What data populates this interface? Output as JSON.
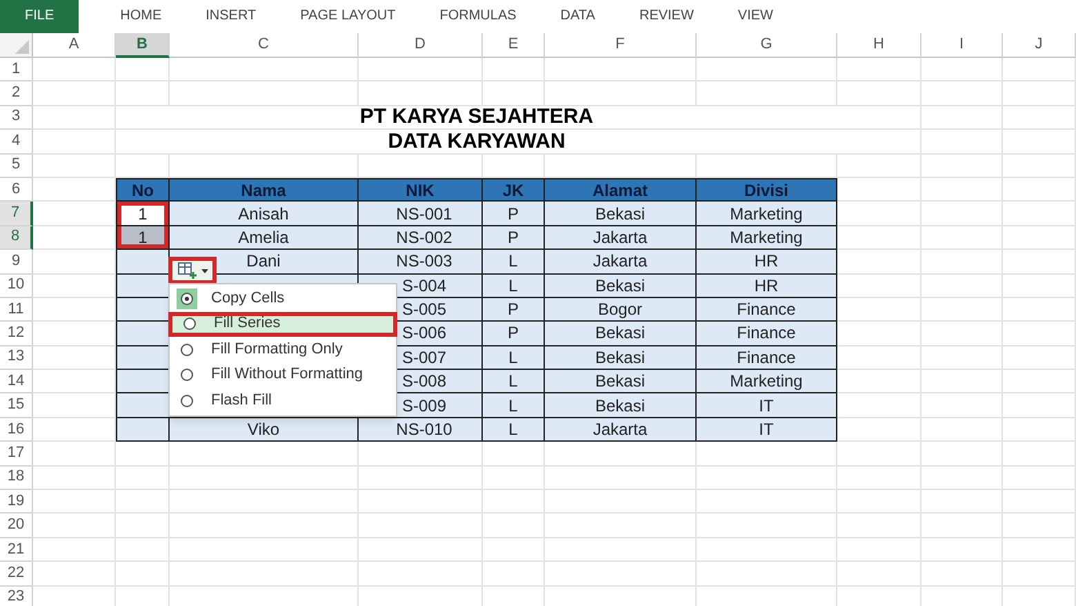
{
  "ribbon_tabs": [
    {
      "label": "FILE",
      "selected": true
    },
    {
      "label": "HOME",
      "selected": false
    },
    {
      "label": "INSERT",
      "selected": false
    },
    {
      "label": "PAGE LAYOUT",
      "selected": false
    },
    {
      "label": "FORMULAS",
      "selected": false
    },
    {
      "label": "DATA",
      "selected": false
    },
    {
      "label": "REVIEW",
      "selected": false
    },
    {
      "label": "VIEW",
      "selected": false
    }
  ],
  "columns": [
    {
      "label": "A",
      "selected": false
    },
    {
      "label": "B",
      "selected": true
    },
    {
      "label": "C",
      "selected": false
    },
    {
      "label": "D",
      "selected": false
    },
    {
      "label": "E",
      "selected": false
    },
    {
      "label": "F",
      "selected": false
    },
    {
      "label": "G",
      "selected": false
    },
    {
      "label": "H",
      "selected": false
    },
    {
      "label": "I",
      "selected": false
    },
    {
      "label": "J",
      "selected": false
    }
  ],
  "row_headers": [
    {
      "label": "1",
      "selected": false
    },
    {
      "label": "2",
      "selected": false
    },
    {
      "label": "3",
      "selected": false
    },
    {
      "label": "4",
      "selected": false
    },
    {
      "label": "5",
      "selected": false
    },
    {
      "label": "6",
      "selected": false
    },
    {
      "label": "7",
      "selected": true
    },
    {
      "label": "8",
      "selected": true
    },
    {
      "label": "9",
      "selected": false
    },
    {
      "label": "10",
      "selected": false
    },
    {
      "label": "11",
      "selected": false
    },
    {
      "label": "12",
      "selected": false
    },
    {
      "label": "13",
      "selected": false
    },
    {
      "label": "14",
      "selected": false
    },
    {
      "label": "15",
      "selected": false
    },
    {
      "label": "16",
      "selected": false
    },
    {
      "label": "17",
      "selected": false
    },
    {
      "label": "18",
      "selected": false
    },
    {
      "label": "19",
      "selected": false
    },
    {
      "label": "20",
      "selected": false
    },
    {
      "label": "21",
      "selected": false
    },
    {
      "label": "22",
      "selected": false
    },
    {
      "label": "23",
      "selected": false
    }
  ],
  "title_lines": [
    "PT KARYA SEJAHTERA",
    "DATA KARYAWAN"
  ],
  "table": {
    "columns": [
      "No",
      "Nama",
      "NIK",
      "JK",
      "Alamat",
      "Divisi"
    ],
    "rows": [
      {
        "cells": [
          "1",
          "Anisah",
          "NS-001",
          "P",
          "Bekasi",
          "Marketing"
        ],
        "no_selected": false,
        "annotated": true
      },
      {
        "cells": [
          "1",
          "Amelia",
          "NS-002",
          "P",
          "Jakarta",
          "Marketing"
        ],
        "no_selected": true,
        "annotated": true
      },
      {
        "cells": [
          "",
          "Dani",
          "NS-003",
          "L",
          "Jakarta",
          "HR"
        ],
        "no_selected": false,
        "annotated": false
      },
      {
        "cells": [
          "",
          "",
          "S-004",
          "L",
          "Bekasi",
          "HR"
        ],
        "no_selected": false,
        "annotated": false
      },
      {
        "cells": [
          "",
          "",
          "S-005",
          "P",
          "Bogor",
          "Finance"
        ],
        "no_selected": false,
        "annotated": false
      },
      {
        "cells": [
          "",
          "",
          "S-006",
          "P",
          "Bekasi",
          "Finance"
        ],
        "no_selected": false,
        "annotated": false
      },
      {
        "cells": [
          "",
          "",
          "S-007",
          "L",
          "Bekasi",
          "Finance"
        ],
        "no_selected": false,
        "annotated": false
      },
      {
        "cells": [
          "",
          "",
          "S-008",
          "L",
          "Bekasi",
          "Marketing"
        ],
        "no_selected": false,
        "annotated": false
      },
      {
        "cells": [
          "",
          "",
          "S-009",
          "L",
          "Bekasi",
          "IT"
        ],
        "no_selected": false,
        "annotated": false
      },
      {
        "cells": [
          "",
          "Viko",
          "NS-010",
          "L",
          "Jakarta",
          "IT"
        ],
        "no_selected": false,
        "annotated": false
      }
    ]
  },
  "autofill_button": {
    "annotated": true
  },
  "autofill_menu": {
    "items": [
      {
        "label": "Copy Cells",
        "selected": true,
        "hovered": false
      },
      {
        "label": "Fill Series",
        "selected": false,
        "hovered": true
      },
      {
        "label": "Fill Formatting Only",
        "selected": false,
        "hovered": false
      },
      {
        "label": "Fill Without Formatting",
        "selected": false,
        "hovered": false
      },
      {
        "label": "Flash Fill",
        "selected": false,
        "hovered": false
      }
    ]
  }
}
